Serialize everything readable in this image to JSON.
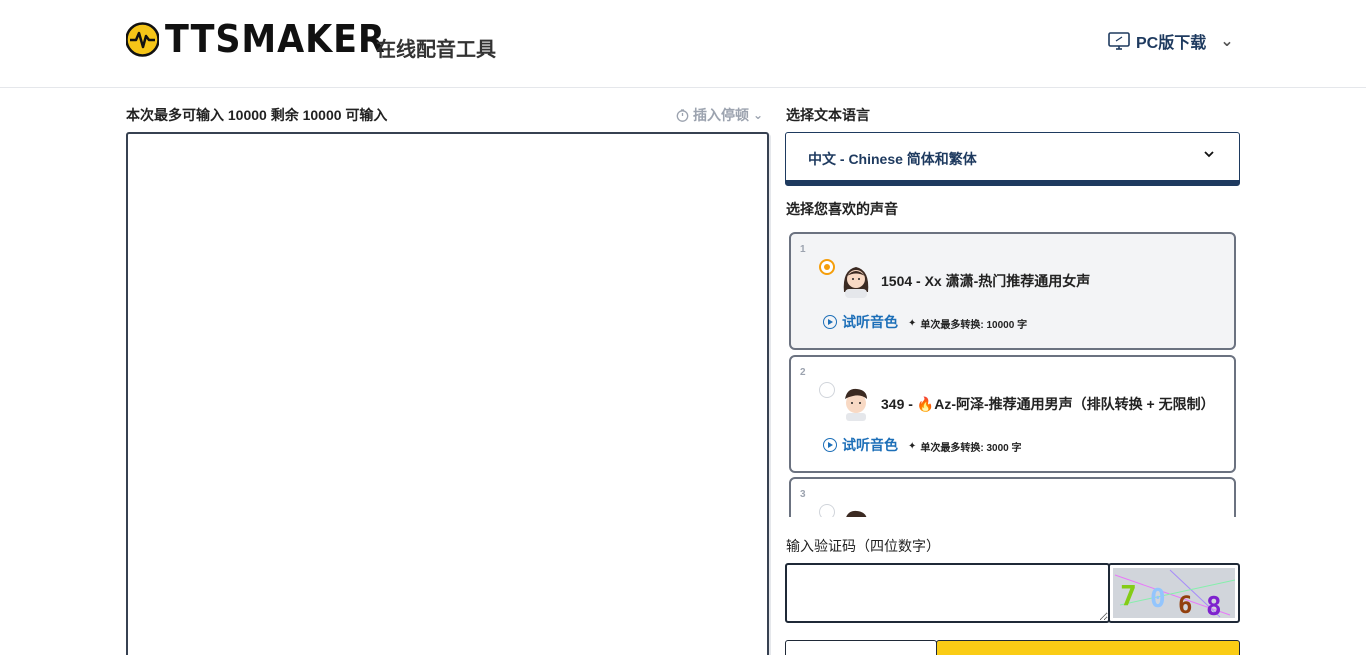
{
  "header": {
    "brand": "TTSMAKER",
    "tagline": "在线配音工具",
    "pc_download": "PC版下载"
  },
  "editor": {
    "quota_text": "本次最多可输入 10000 剩余 10000 可输入",
    "insert_pause": "插入停顿",
    "text_value": ""
  },
  "language": {
    "label": "选择文本语言",
    "selected": "中文 - Chinese 简体和繁体"
  },
  "voices": {
    "label": "选择您喜欢的声音",
    "preview_label": "试听音色",
    "items": [
      {
        "index": "1",
        "name": "1504 - Xx 潇潇-热门推荐通用女声",
        "limit": "单次最多转换: 10000 字",
        "selected": true
      },
      {
        "index": "2",
        "name": "349 - 🔥Az-阿泽-推荐通用男声（排队转换 + 无限制）",
        "limit": "单次最多转换: 3000 字",
        "selected": false
      },
      {
        "index": "3",
        "name": "",
        "limit": "",
        "selected": false
      }
    ]
  },
  "captcha": {
    "label": "输入验证码（四位数字）",
    "value": "",
    "digits": [
      "7",
      "0",
      "6",
      "8"
    ]
  },
  "colors": {
    "accent_yellow": "#facc15",
    "navy": "#1e3a5f",
    "link_blue": "#1d6fb8",
    "radio_orange": "#f59e0b"
  }
}
